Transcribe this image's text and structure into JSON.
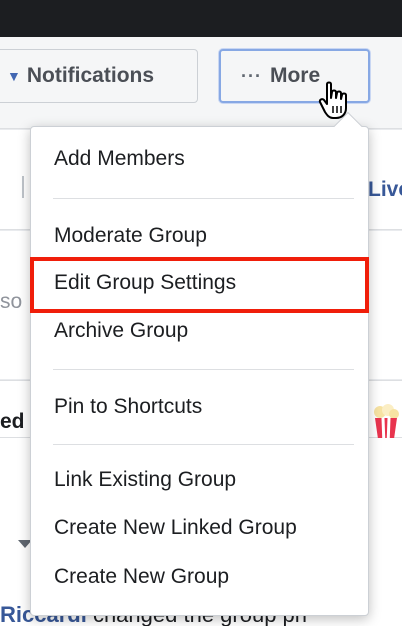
{
  "header": {
    "notifications_label": "Notifications",
    "more_label": "More",
    "more_dots": "···"
  },
  "background": {
    "live_fragment": "Live",
    "so_fragment": "so",
    "ed_fragment": "ed",
    "bottom_name": "Riccardi",
    "bottom_text": " changed the group pri"
  },
  "menu": {
    "items": [
      {
        "label": "Add Members"
      },
      {
        "label": "Moderate Group"
      },
      {
        "label": "Edit Group Settings"
      },
      {
        "label": "Archive Group"
      },
      {
        "label": "Pin to Shortcuts"
      },
      {
        "label": "Link Existing Group"
      },
      {
        "label": "Create New Linked Group"
      },
      {
        "label": "Create New Group"
      }
    ]
  },
  "colors": {
    "highlight": "#f01e0a",
    "focus_ring": "#87a8e4"
  }
}
